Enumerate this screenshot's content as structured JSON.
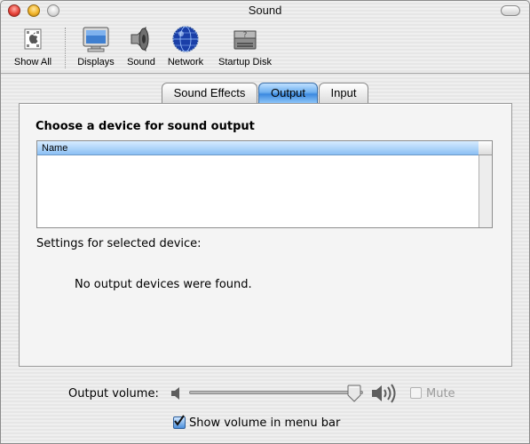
{
  "window": {
    "title": "Sound"
  },
  "toolbar": {
    "items": [
      {
        "label": "Show All",
        "icon": "apple-icon"
      },
      {
        "label": "Displays",
        "icon": "display-icon"
      },
      {
        "label": "Sound",
        "icon": "speaker-icon"
      },
      {
        "label": "Network",
        "icon": "globe-icon"
      },
      {
        "label": "Startup Disk",
        "icon": "disk-icon"
      }
    ]
  },
  "tabs": [
    {
      "label": "Sound Effects",
      "selected": false
    },
    {
      "label": "Output",
      "selected": true
    },
    {
      "label": "Input",
      "selected": false
    }
  ],
  "output": {
    "heading": "Choose a device for sound output",
    "list_column": "Name",
    "settings_label": "Settings for selected device:",
    "empty_message": "No output devices were found."
  },
  "volume": {
    "label": "Output volume:",
    "level": 0.95,
    "mute_label": "Mute",
    "mute_checked": false,
    "mute_enabled": false
  },
  "menubar": {
    "label": "Show volume in menu bar",
    "checked": true
  },
  "colors": {
    "accent": "#3c8ae0",
    "header_blue": "#8cc0f4"
  }
}
